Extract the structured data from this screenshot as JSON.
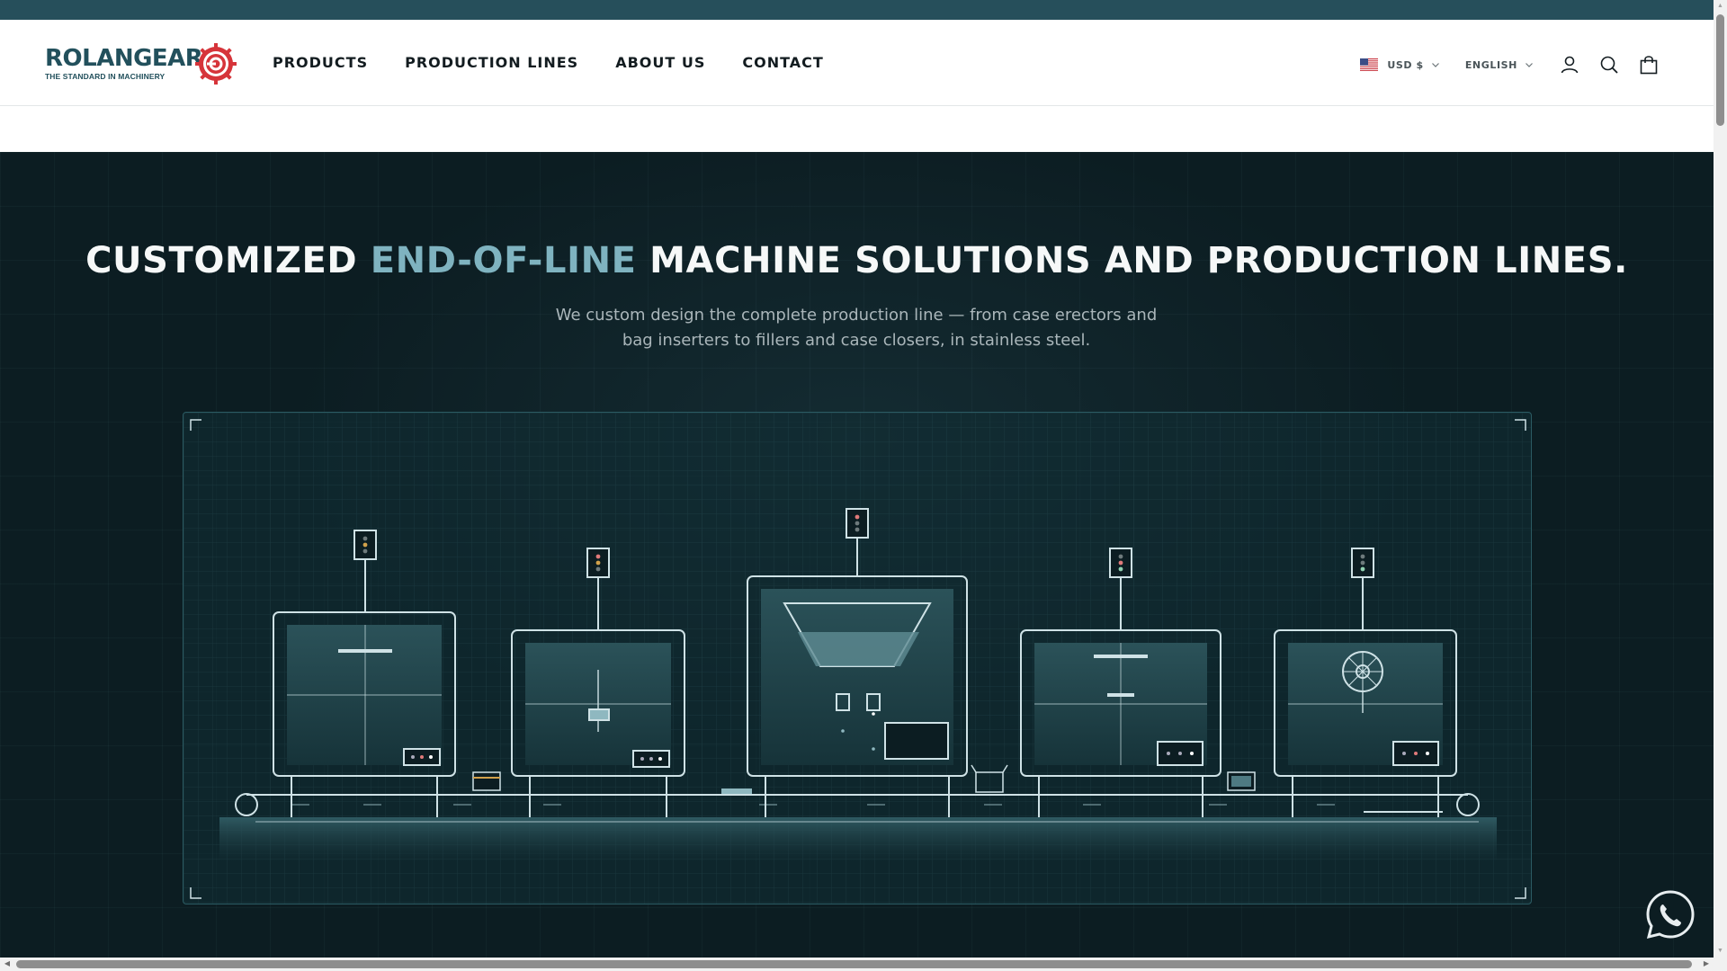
{
  "brand": {
    "name": "ROLANGEAR",
    "registered_mark": "®",
    "tagline": "THE STANDARD IN MACHINERY",
    "color": "#22505c",
    "accent_color": "#d6343a"
  },
  "nav": {
    "items": [
      {
        "label": "PRODUCTS"
      },
      {
        "label": "PRODUCTION LINES"
      },
      {
        "label": "ABOUT US"
      },
      {
        "label": "CONTACT"
      }
    ]
  },
  "header": {
    "currency": {
      "label": "USD $",
      "flag": "us-flag-icon"
    },
    "language": {
      "label": "ENGLISH"
    },
    "icons": [
      "account-icon",
      "search-icon",
      "cart-icon"
    ]
  },
  "hero": {
    "title_start": "CUSTOMIZED ",
    "title_accent": "END-OF-LINE",
    "title_end": " MACHINE SOLUTIONS AND PRODUCTION LINES.",
    "subtitle": "We custom design the complete production line — from case erectors and bag inserters to fillers and case closers, in stainless steel.",
    "illustration": "production-line-illustration",
    "accent_color": "#7fb3c0",
    "background_color": "#0c1d22"
  },
  "chat_widget": {
    "icon": "whatsapp-icon"
  }
}
